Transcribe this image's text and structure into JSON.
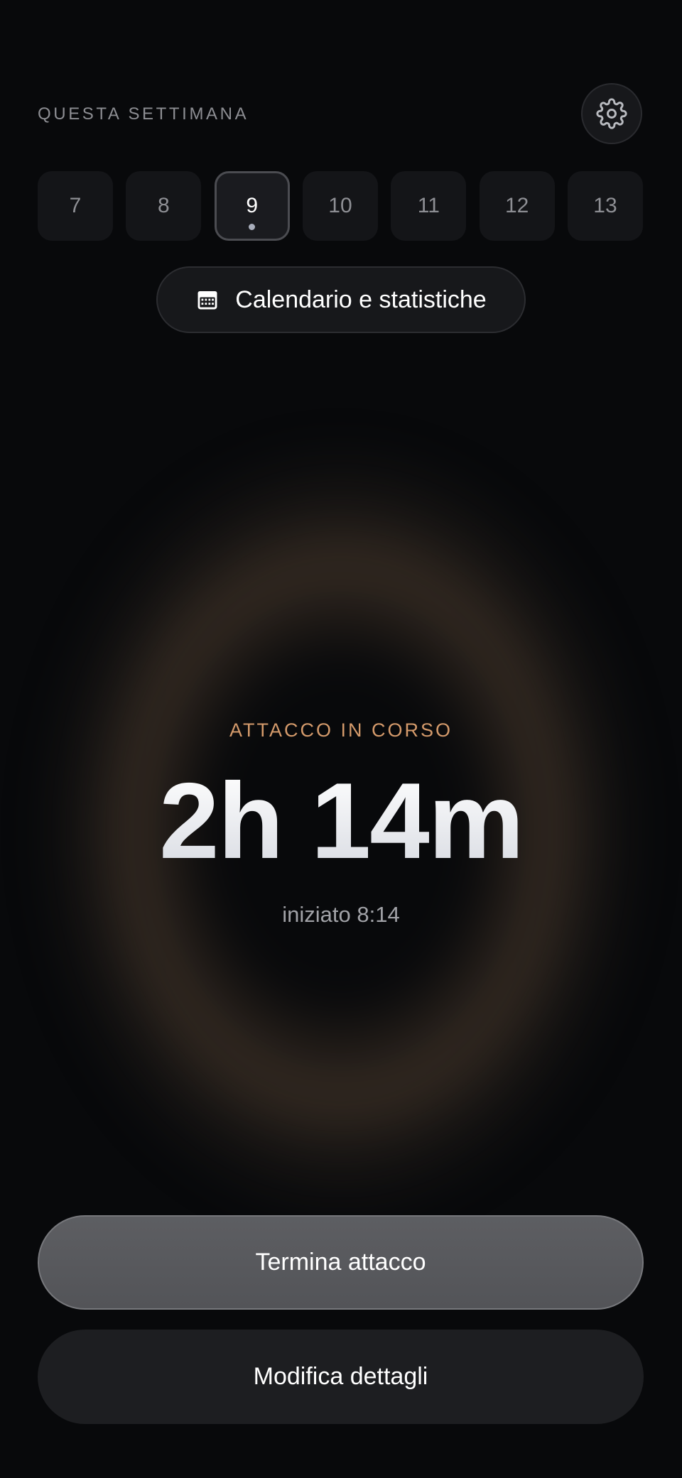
{
  "header": {
    "section_label": "QUESTA SETTIMANA",
    "settings_icon": "gear-icon"
  },
  "week": {
    "days": [
      {
        "label": "7",
        "active": false
      },
      {
        "label": "8",
        "active": false
      },
      {
        "label": "9",
        "active": true,
        "has_event": true
      },
      {
        "label": "10",
        "active": false
      },
      {
        "label": "11",
        "active": false
      },
      {
        "label": "12",
        "active": false
      },
      {
        "label": "13",
        "active": false
      }
    ]
  },
  "calendar_button": {
    "icon": "calendar-icon",
    "label": "Calendario e statistiche"
  },
  "attack": {
    "status_label": "ATTACCO IN CORSO",
    "duration": "2h 14m",
    "started": "iniziato 8:14"
  },
  "actions": {
    "end_label": "Termina attacco",
    "edit_label": "Modifica dettagli"
  },
  "colors": {
    "background": "#08090b",
    "accent": "#d49a6b",
    "glow": "#3c3026"
  }
}
